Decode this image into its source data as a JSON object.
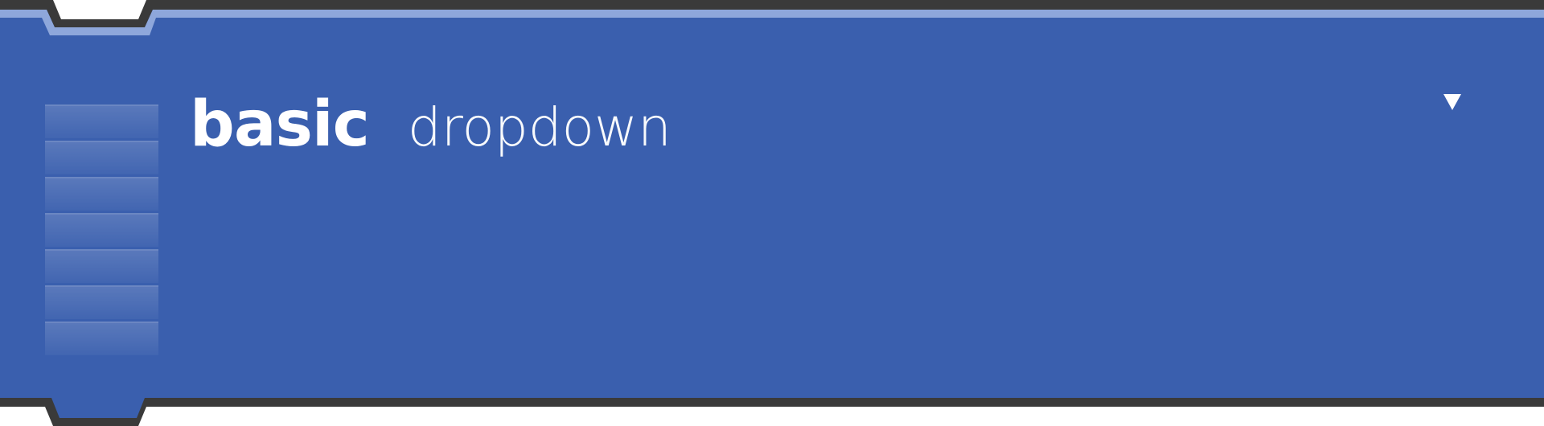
{
  "block": {
    "keyword": "basic",
    "label": "dropdown",
    "dropdown_icon": "triangle-down-icon",
    "fill_color": "#3a5fae",
    "highlight_color": "#8ea7db",
    "outline_color": "#3a3a3a"
  }
}
